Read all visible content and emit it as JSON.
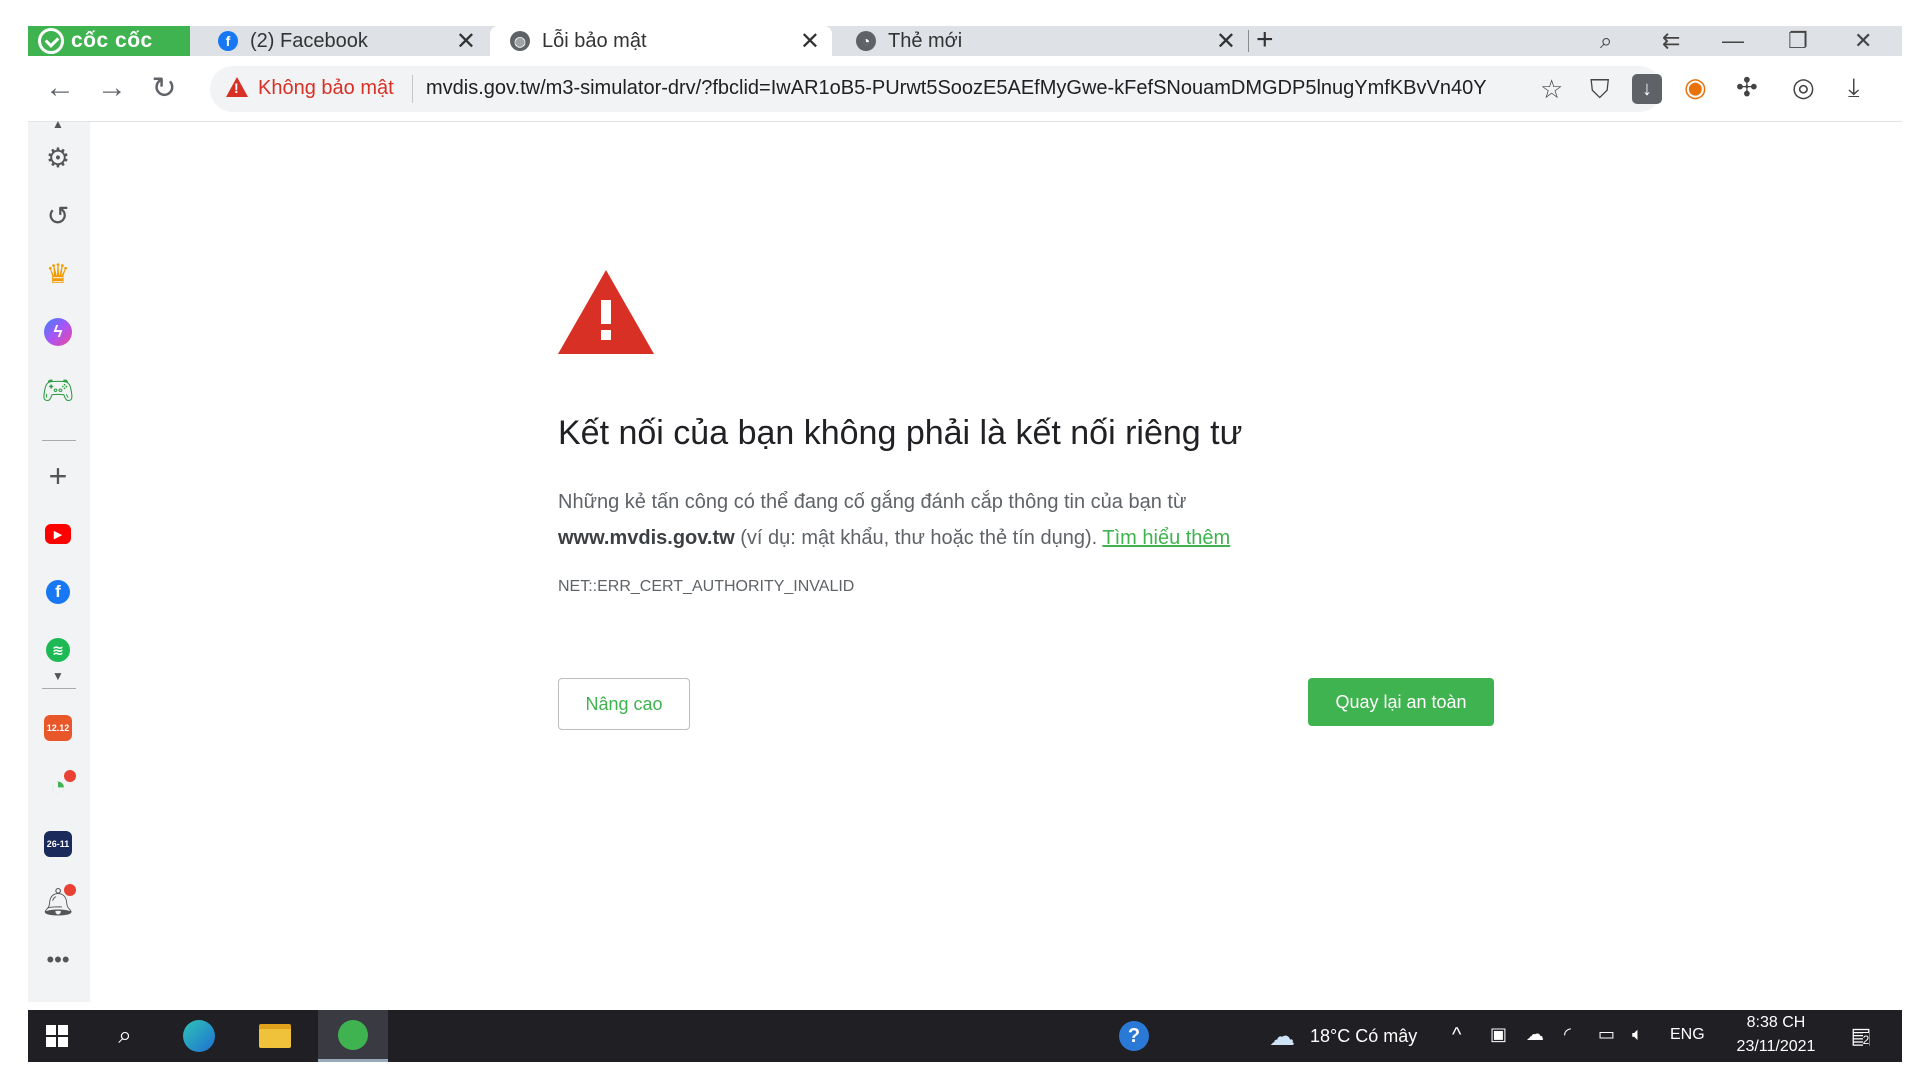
{
  "browser": {
    "brand": "cốc cốc",
    "tabs": [
      {
        "title": "(2) Facebook",
        "active": false
      },
      {
        "title": "Lỗi bảo mật",
        "active": true
      },
      {
        "title": "Thẻ mới",
        "active": false
      }
    ],
    "security_label": "Không bảo mật",
    "url": "mvdis.gov.tw/m3-simulator-drv/?fbclid=IwAR1oB5-PUrwt5SoozE5AEfMyGwe-kFefSNouamDMGDP5lnugYmfKBvVn40Y"
  },
  "error_page": {
    "headline": "Kết nối của bạn không phải là kết nối riêng tư",
    "desc_line1": "Những kẻ tấn công có thể đang cố gắng đánh cắp thông tin của bạn từ",
    "domain": "www.mvdis.gov.tw",
    "desc_line2": " (ví dụ: mật khẩu, thư hoặc thẻ tín dụng). ",
    "learn_more": "Tìm hiểu thêm",
    "error_code": "NET::ERR_CERT_AUTHORITY_INVALID",
    "advanced_button": "Nâng cao",
    "back_button": "Quay lại an toàn"
  },
  "sidebar": {
    "calendar_badge": "12.12",
    "tiki_badge": "26-11"
  },
  "taskbar": {
    "weather": "18°C  Có mây",
    "language": "ENG",
    "time": "8:38 CH",
    "date": "23/11/2021",
    "notification_count": "2"
  },
  "colors": {
    "accent_green": "#3fb34f",
    "warning_red": "#d93025",
    "taskbar_bg": "#1f1f24"
  }
}
